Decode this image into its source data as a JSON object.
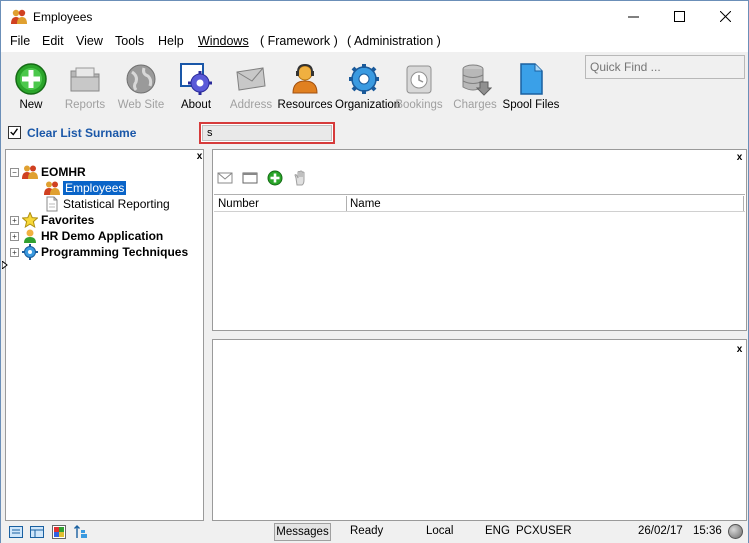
{
  "window": {
    "title": "Employees"
  },
  "menu": [
    "File",
    "Edit",
    "View",
    "Tools",
    "Help",
    "Windows",
    "( Framework )",
    "( Administration )"
  ],
  "toolbar": {
    "new": "New",
    "reports": "Reports",
    "website": "Web Site",
    "about": "About",
    "address": "Address",
    "resources": "Resources",
    "organization": "Organization",
    "bookings": "Bookings",
    "charges": "Charges",
    "spool": "Spool Files"
  },
  "quick_find": {
    "placeholder": "Quick Find ..."
  },
  "filter": {
    "checkbox_label": "Clear List Surname",
    "checked": true,
    "search_value": "s"
  },
  "tree": {
    "root": "EOMHR",
    "root_children": [
      "Employees",
      "Statistical Reporting"
    ],
    "nodes": [
      "Favorites",
      "HR Demo Application",
      "Programming Techniques"
    ]
  },
  "list": {
    "columns": [
      "Number",
      "Name"
    ]
  },
  "close_label": "x",
  "status": {
    "messages": "Messages",
    "state": "Ready",
    "location": "Local",
    "language": "ENG",
    "user": "PCXUSER",
    "date": "26/02/17",
    "time": "15:36"
  },
  "colors": {
    "accent": "#1a57a8",
    "selection": "#0a64c8",
    "highlight": "#d63b3b"
  }
}
